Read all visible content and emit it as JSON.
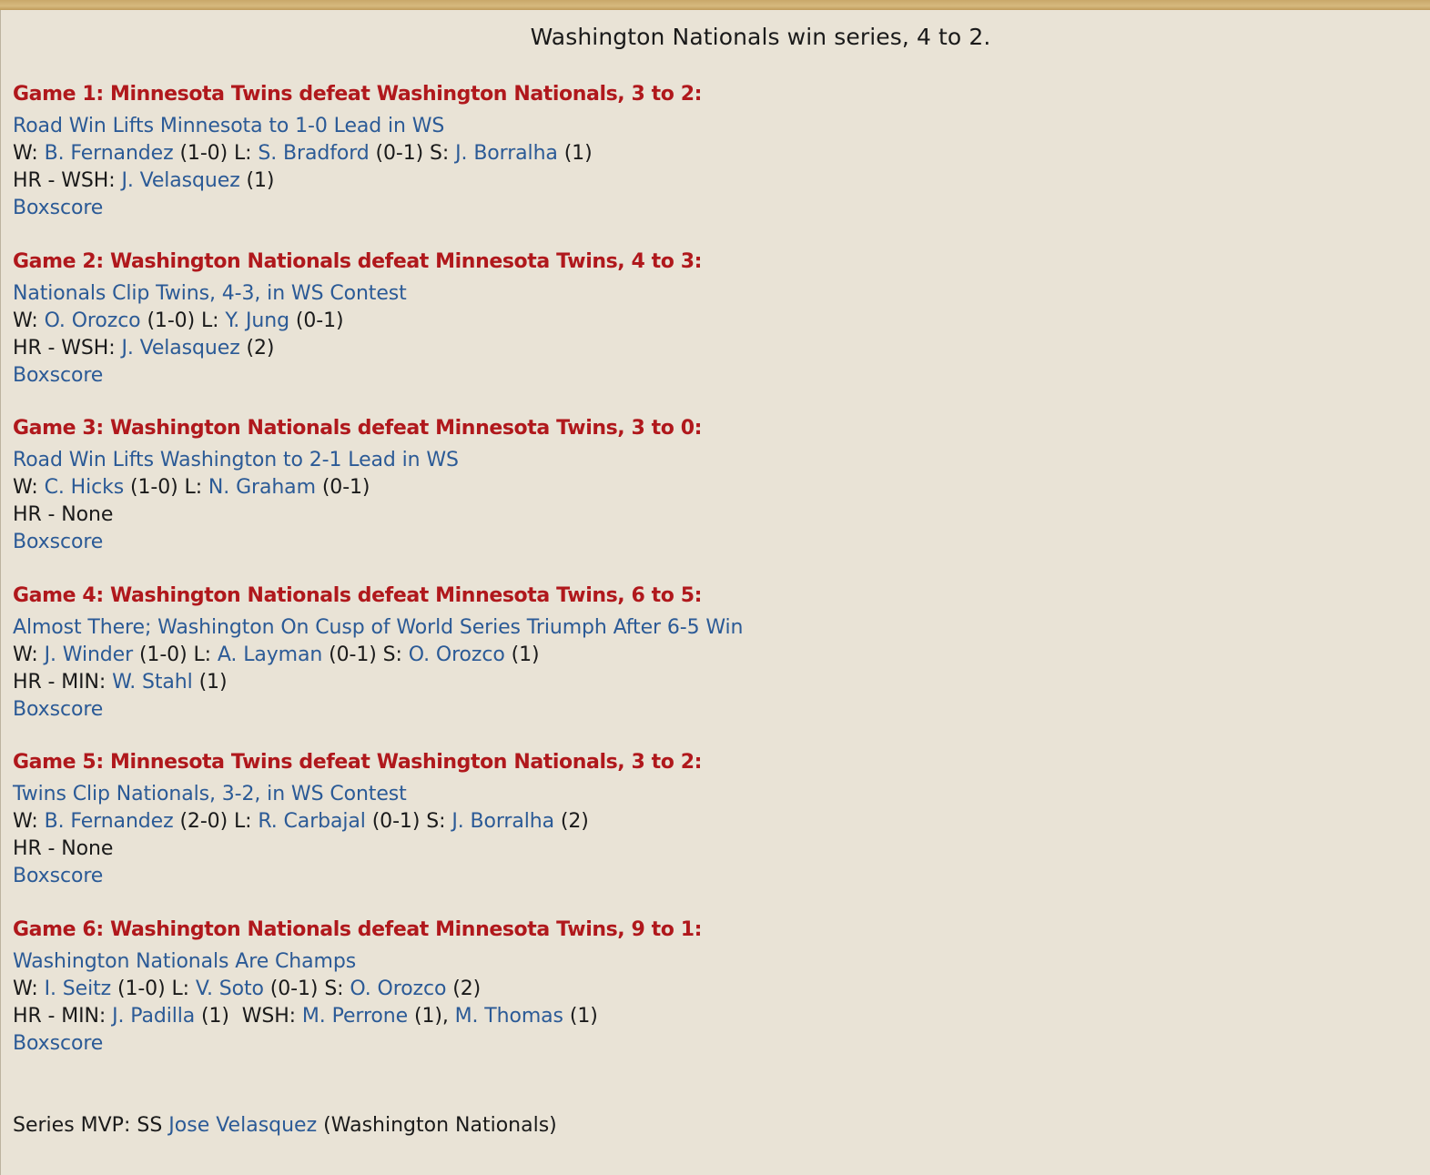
{
  "series_result": "Washington Nationals win series, 4 to 2.",
  "games": [
    {
      "title": "Game 1: Minnesota Twins defeat Washington Nationals, 3 to 2:",
      "headline": "Road Win Lifts Minnesota to 1-0 Lead in WS",
      "w_label": "W:",
      "w_name": "B. Fernandez",
      "w_rec": "(1-0)",
      "l_label": "L:",
      "l_name": "S. Bradford",
      "l_rec": "(0-1)",
      "s_label": "S:",
      "s_name": "J. Borralha",
      "s_rec": "(1)",
      "hr_prefix": "HR - WSH:",
      "hr1_name": "J. Velasquez",
      "hr1_count": "(1)",
      "boxscore": "Boxscore"
    },
    {
      "title": "Game 2: Washington Nationals defeat Minnesota Twins, 4 to 3:",
      "headline": "Nationals Clip Twins, 4-3, in WS Contest",
      "w_label": "W:",
      "w_name": "O. Orozco",
      "w_rec": "(1-0)",
      "l_label": "L:",
      "l_name": "Y. Jung",
      "l_rec": "(0-1)",
      "hr_prefix": "HR - WSH:",
      "hr1_name": "J. Velasquez",
      "hr1_count": "(2)",
      "boxscore": "Boxscore"
    },
    {
      "title": "Game 3: Washington Nationals defeat Minnesota Twins, 3 to 0:",
      "headline": "Road Win Lifts Washington to 2-1 Lead in WS",
      "w_label": "W:",
      "w_name": "C. Hicks",
      "w_rec": "(1-0)",
      "l_label": "L:",
      "l_name": "N. Graham",
      "l_rec": "(0-1)",
      "hr_prefix": "HR - None",
      "boxscore": "Boxscore"
    },
    {
      "title": "Game 4: Washington Nationals defeat Minnesota Twins, 6 to 5:",
      "headline": "Almost There; Washington On Cusp of World Series Triumph After 6-5 Win",
      "w_label": "W:",
      "w_name": "J. Winder",
      "w_rec": "(1-0)",
      "l_label": "L:",
      "l_name": "A. Layman",
      "l_rec": "(0-1)",
      "s_label": "S:",
      "s_name": "O. Orozco",
      "s_rec": "(1)",
      "hr_prefix": "HR - MIN:",
      "hr1_name": "W. Stahl",
      "hr1_count": "(1)",
      "boxscore": "Boxscore"
    },
    {
      "title": "Game 5: Minnesota Twins defeat Washington Nationals, 3 to 2:",
      "headline": "Twins Clip Nationals, 3-2, in WS Contest",
      "w_label": "W:",
      "w_name": "B. Fernandez",
      "w_rec": "(2-0)",
      "l_label": "L:",
      "l_name": "R. Carbajal",
      "l_rec": "(0-1)",
      "s_label": "S:",
      "s_name": "J. Borralha",
      "s_rec": "(2)",
      "hr_prefix": "HR - None",
      "boxscore": "Boxscore"
    },
    {
      "title": "Game 6: Washington Nationals defeat Minnesota Twins, 9 to 1:",
      "headline": "Washington Nationals Are Champs",
      "w_label": "W:",
      "w_name": "I. Seitz",
      "w_rec": "(1-0)",
      "l_label": "L:",
      "l_name": "V. Soto",
      "l_rec": "(0-1)",
      "s_label": "S:",
      "s_name": "O. Orozco",
      "s_rec": "(2)",
      "hr_prefix": "HR - MIN:",
      "hr1_name": "J. Padilla",
      "hr1_count": "(1)",
      "hr_team2": "WSH:",
      "hr2_name": "M. Perrone",
      "hr2_count": "(1),",
      "hr3_name": "M. Thomas",
      "hr3_count": "(1)",
      "boxscore": "Boxscore"
    }
  ],
  "mvp": {
    "prefix": "Series MVP: SS",
    "name": "Jose Velasquez",
    "team": "(Washington Nationals)"
  }
}
